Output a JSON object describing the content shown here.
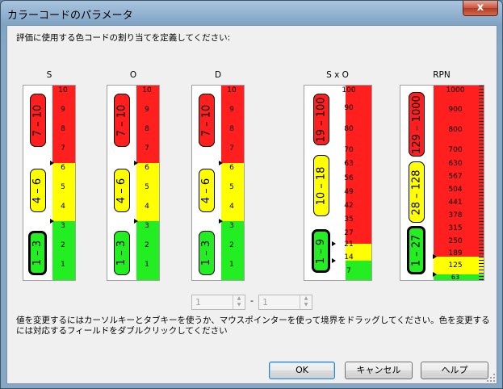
{
  "window": {
    "title": "カラーコードのパラメータ",
    "close_glyph": "x"
  },
  "instruction": "評価に使用する色コードの割り当てを定義してください:",
  "panels": [
    {
      "id": "s",
      "header": "S",
      "ticks": [
        "10",
        "9",
        "8",
        "7",
        "6",
        "5",
        "4",
        "3",
        "2",
        "1"
      ],
      "ranges": [
        "7 – 10",
        "4 – 6",
        "1 – 3"
      ]
    },
    {
      "id": "o",
      "header": "O",
      "ticks": [
        "10",
        "9",
        "8",
        "7",
        "6",
        "5",
        "4",
        "3",
        "2",
        "1"
      ],
      "ranges": [
        "7 – 10",
        "4 – 6",
        "1 – 3"
      ]
    },
    {
      "id": "d",
      "header": "D",
      "ticks": [
        "10",
        "9",
        "8",
        "7",
        "6",
        "5",
        "4",
        "3",
        "2",
        "1"
      ],
      "ranges": [
        "7 – 10",
        "4 – 6",
        "1 – 3"
      ]
    },
    {
      "id": "sxo",
      "header": "S x O",
      "ticks": [
        "100",
        "90",
        "80",
        "70",
        "63",
        "56",
        "49",
        "42",
        "35",
        "27",
        "21",
        "14",
        "7"
      ],
      "ranges": [
        "19 – 100",
        "10 – 18",
        "1 – 9"
      ]
    },
    {
      "id": "rpn",
      "header": "RPN",
      "ticks": [
        "1000",
        "900",
        "800",
        "700",
        "630",
        "567",
        "504",
        "441",
        "378",
        "315",
        "250",
        "189",
        "125",
        "63"
      ],
      "ranges": [
        "129 – 1000",
        "28 – 128",
        "1 – 27"
      ]
    }
  ],
  "range_editor": {
    "from_value": "1",
    "separator": "-",
    "to_value": "1"
  },
  "help_text": "値を変更するにはカーソルキーとタブキーを使うか、マウスポインターを使って境界をドラッグしてください。色を変更するには対応するフィールドをダブルクリックしてください",
  "buttons": {
    "ok": "OK",
    "cancel": "キャンセル",
    "help": "ヘルプ"
  },
  "colors": {
    "high": "#ff1f1f",
    "medium": "#ffff00",
    "low": "#22ee22"
  }
}
